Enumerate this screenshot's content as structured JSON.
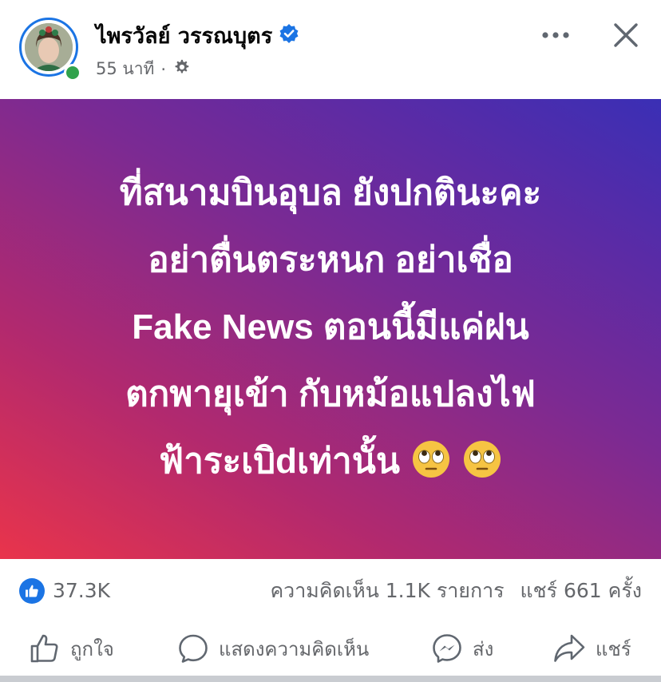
{
  "post": {
    "author": "ไพรวัลย์ วรรณบุตร",
    "verified": true,
    "time": "55 นาที",
    "separator": "·",
    "audience_icon": "gear-icon",
    "content_lines": [
      "ที่สนามบินอุบล ยังปกตินะคะ",
      "อย่าตื่นตระหนก อย่าเชื่อ",
      "Fake News ตอนนี้มีแค่ฝน",
      "ตกพายุเข้า กับหม้อแปลงไฟ",
      "ฟ้าระเบิdเท่านั้น"
    ],
    "content_emoji": [
      "face-with-rolling-eyes-emoji",
      "face-with-rolling-eyes-emoji"
    ]
  },
  "stats": {
    "likes": "37.3K",
    "comments": "ความคิดเห็น 1.1K รายการ",
    "shares": "แชร์ 661 ครั้ง"
  },
  "actions": {
    "like": "ถูกใจ",
    "comment": "แสดงความคิดเห็น",
    "send": "ส่ง",
    "share": "แชร์"
  },
  "colors": {
    "accent": "#1b74e4",
    "online": "#31a24c",
    "secondary_text": "#65676b",
    "gradient_start": "#e9344b",
    "gradient_end": "#3a2fb5"
  }
}
